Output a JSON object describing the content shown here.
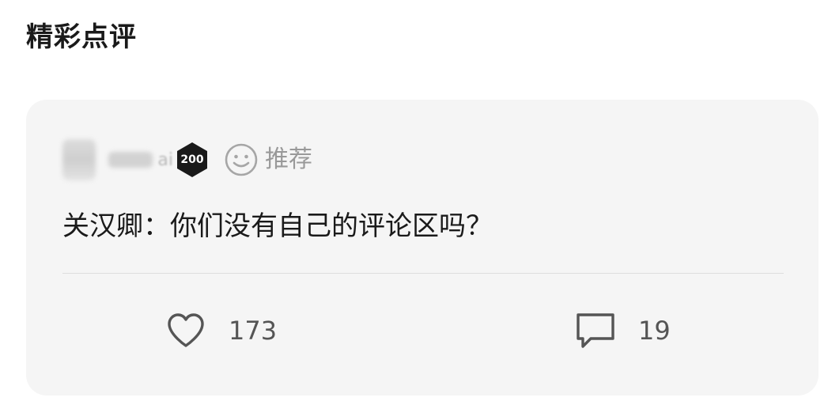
{
  "section": {
    "title": "精彩点评"
  },
  "comment": {
    "user": {
      "name_visible_tail": "ai",
      "level": "200"
    },
    "tag": {
      "label": "推荐",
      "icon": "smile-icon"
    },
    "text": "关汉卿：你们没有自己的评论区吗？",
    "actions": {
      "likes": "173",
      "replies": "19",
      "like_icon": "heart-icon",
      "reply_icon": "comment-bubble-icon"
    }
  },
  "colors": {
    "card_bg": "#f5f5f5",
    "badge_bg": "#1a1a1a",
    "muted": "#999999",
    "text": "#1a1a1a"
  }
}
